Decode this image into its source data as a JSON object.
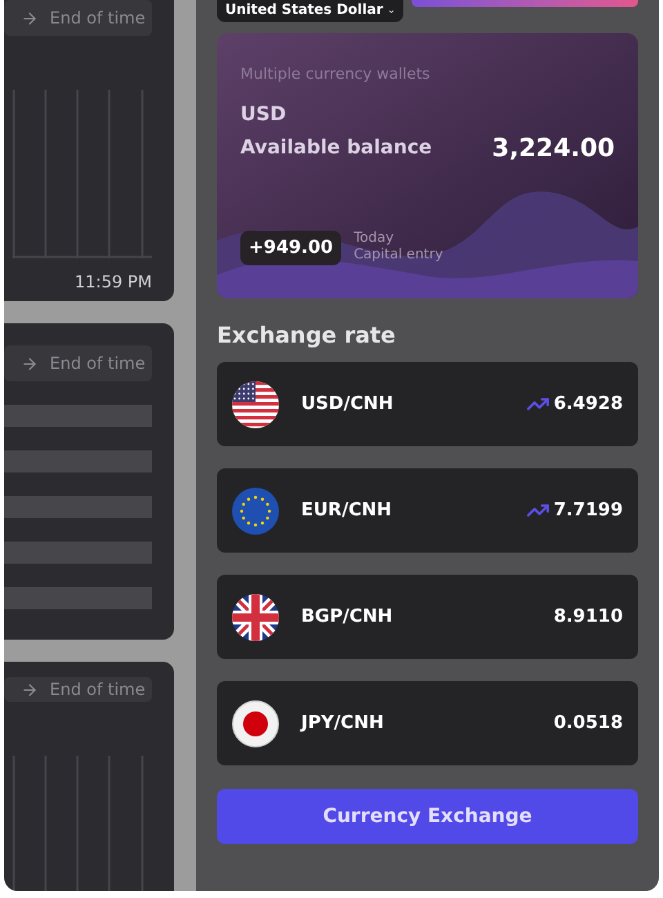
{
  "left_cards": [
    {
      "kind": "grid",
      "filter": "End of time",
      "time": "11:59 PM"
    },
    {
      "kind": "rows",
      "filter": "End of time"
    },
    {
      "kind": "grid",
      "filter": "End of time"
    }
  ],
  "currency_select": {
    "value": "United States Dollar"
  },
  "wallet": {
    "title": "Multiple currency wallets",
    "currency": "USD",
    "balance_label": "Available balance",
    "balance": "3,224.00",
    "change": "+949.00",
    "change_when": "Today",
    "change_label": "Capital entry"
  },
  "exchange_rate": {
    "title": "Exchange rate",
    "rates": [
      {
        "kind": "us",
        "pair": "USD/CNH",
        "trend_up": true,
        "rate": "6.4928"
      },
      {
        "kind": "eu",
        "pair": "EUR/CNH",
        "trend_up": true,
        "rate": "7.7199"
      },
      {
        "kind": "gb",
        "pair": "BGP/CNH",
        "trend_up": false,
        "rate": "8.9110"
      },
      {
        "kind": "jp",
        "pair": "JPY/CNH",
        "trend_up": false,
        "rate": "0.0518"
      }
    ]
  },
  "button": "Currency Exchange"
}
